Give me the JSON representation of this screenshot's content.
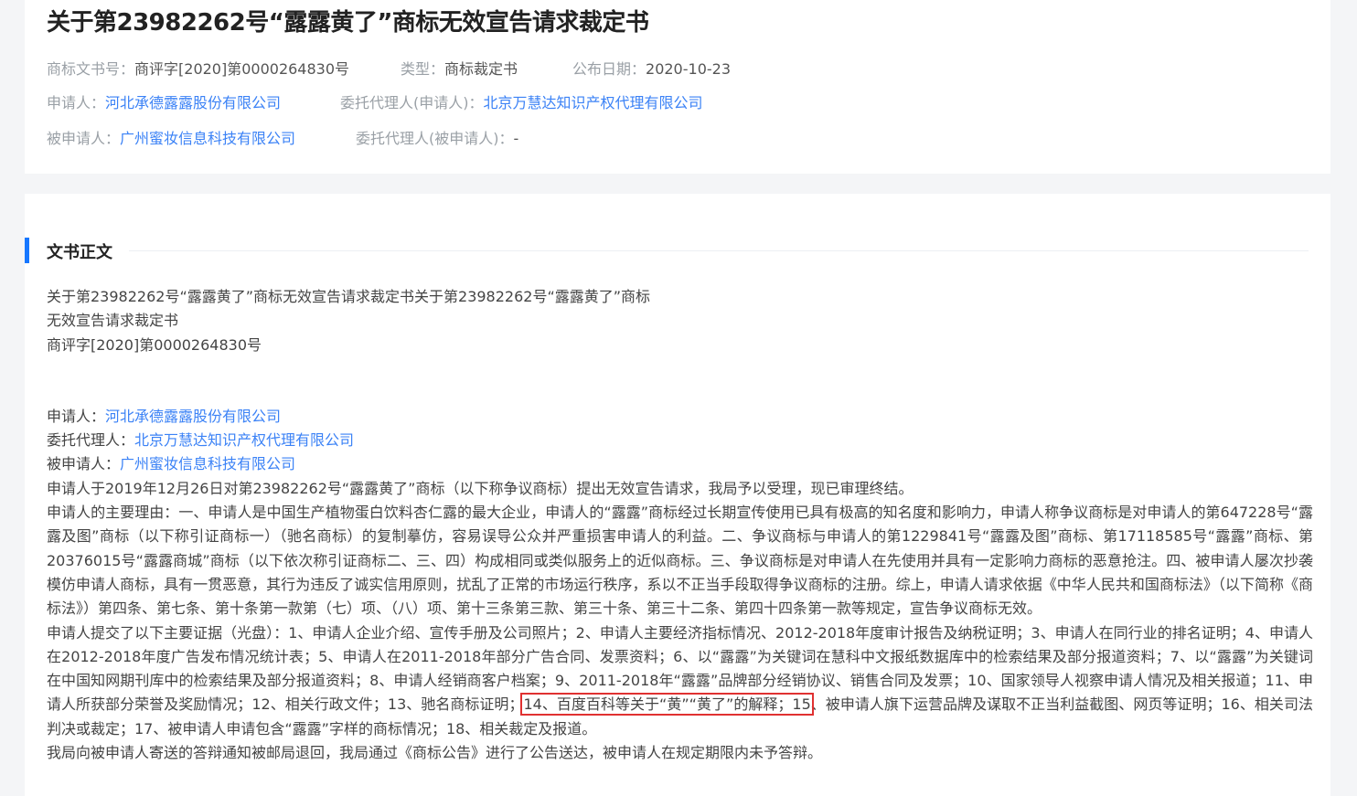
{
  "header": {
    "title": "关于第23982262号“露露黄了”商标无效宣告请求裁定书",
    "doc_no_label": "商标文书号：",
    "doc_no": "商评字[2020]第0000264830号",
    "type_label": "类型：",
    "type": "商标裁定书",
    "pub_date_label": "公布日期：",
    "pub_date": "2020-10-23",
    "applicant_label": "申请人：",
    "applicant": "河北承德露露股份有限公司",
    "applicant_agent_label": "委托代理人(申请人)：",
    "applicant_agent": "北京万慧达知识产权代理有限公司",
    "respondent_label": "被申请人：",
    "respondent": "广州蜜妆信息科技有限公司",
    "respondent_agent_label": "委托代理人(被申请人)：",
    "respondent_agent": "-"
  },
  "body": {
    "section_title": "文书正文",
    "heading_line1": "关于第23982262号“露露黄了”商标无效宣告请求裁定书关于第23982262号“露露黄了”商标",
    "heading_line2": "无效宣告请求裁定书",
    "heading_line3": "商评字[2020]第0000264830号",
    "applicant_label": "申请人：",
    "applicant": "河北承德露露股份有限公司",
    "agent_label": "委托代理人：",
    "agent": "北京万慧达知识产权代理有限公司",
    "respondent_label": "被申请人：",
    "respondent": "广州蜜妆信息科技有限公司",
    "para1": "申请人于2019年12月26日对第23982262号“露露黄了”商标（以下称争议商标）提出无效宣告请求，我局予以受理，现已审理终结。",
    "para2": "申请人的主要理由：一、申请人是中国生产植物蛋白饮料杏仁露的最大企业，申请人的“露露”商标经过长期宣传使用已具有极高的知名度和影响力，申请人称争议商标是对申请人的第647228号“露露及图”商标（以下称引证商标一）（驰名商标）的复制摹仿，容易误导公众并严重损害申请人的利益。二、争议商标与申请人的第1229841号“露露及图”商标、第17118585号“露露”商标、第20376015号“露露商城”商标（以下依次称引证商标二、三、四）构成相同或类似服务上的近似商标。三、争议商标是对申请人在先使用并具有一定影响力商标的恶意抢注。四、被申请人屡次抄袭模仿申请人商标，具有一贯恶意，其行为违反了诚实信用原则，扰乱了正常的市场运行秩序，系以不正当手段取得争议商标的注册。综上，申请人请求依据《中华人民共和国商标法》（以下简称《商标法》）第四条、第七条、第十条第一款第（七）项、（八）项、第十三条第三款、第三十条、第三十二条、第四十四条第一款等规定，宣告争议商标无效。",
    "para3_before": "申请人提交了以下主要证据（光盘）：1、申请人企业介绍、宣传手册及公司照片；2、申请人主要经济指标情况、2012-2018年度审计报告及纳税证明；3、申请人在同行业的排名证明；4、申请人在2012-2018年度广告发布情况统计表；5、申请人在2011-2018年部分广告合同、发票资料；6、以“露露”为关键词在慧科中文报纸数据库中的检索结果及部分报道资料；7、以“露露”为关键词在中国知网期刊库中的检索结果及部分报道资料；8、申请人经销商客户档案；9、2011-2018年“露露”品牌部分经销协议、销售合同及发票；10、国家领导人视察申请人情况及相关报道；11、申请人所获部分荣誉及奖励情况；12、相关行政文件；13、驰名商标证明；",
    "para3_highlight": "14、百度百科等关于“黄”“黄了”的解释；15",
    "para3_after": "、被申请人旗下运营品牌及谋取不正当利益截图、网页等证明；16、相关司法判决或裁定；17、被申请人申请包含“露露”字样的商标情况；18、相关裁定及报道。",
    "para4": "我局向被申请人寄送的答辩通知被邮局退回，我局通过《商标公告》进行了公告送达，被申请人在规定期限内未予答辩。"
  },
  "colors": {
    "accent": "#1677ff",
    "link": "#3b82f6",
    "highlight": "#e03131"
  }
}
